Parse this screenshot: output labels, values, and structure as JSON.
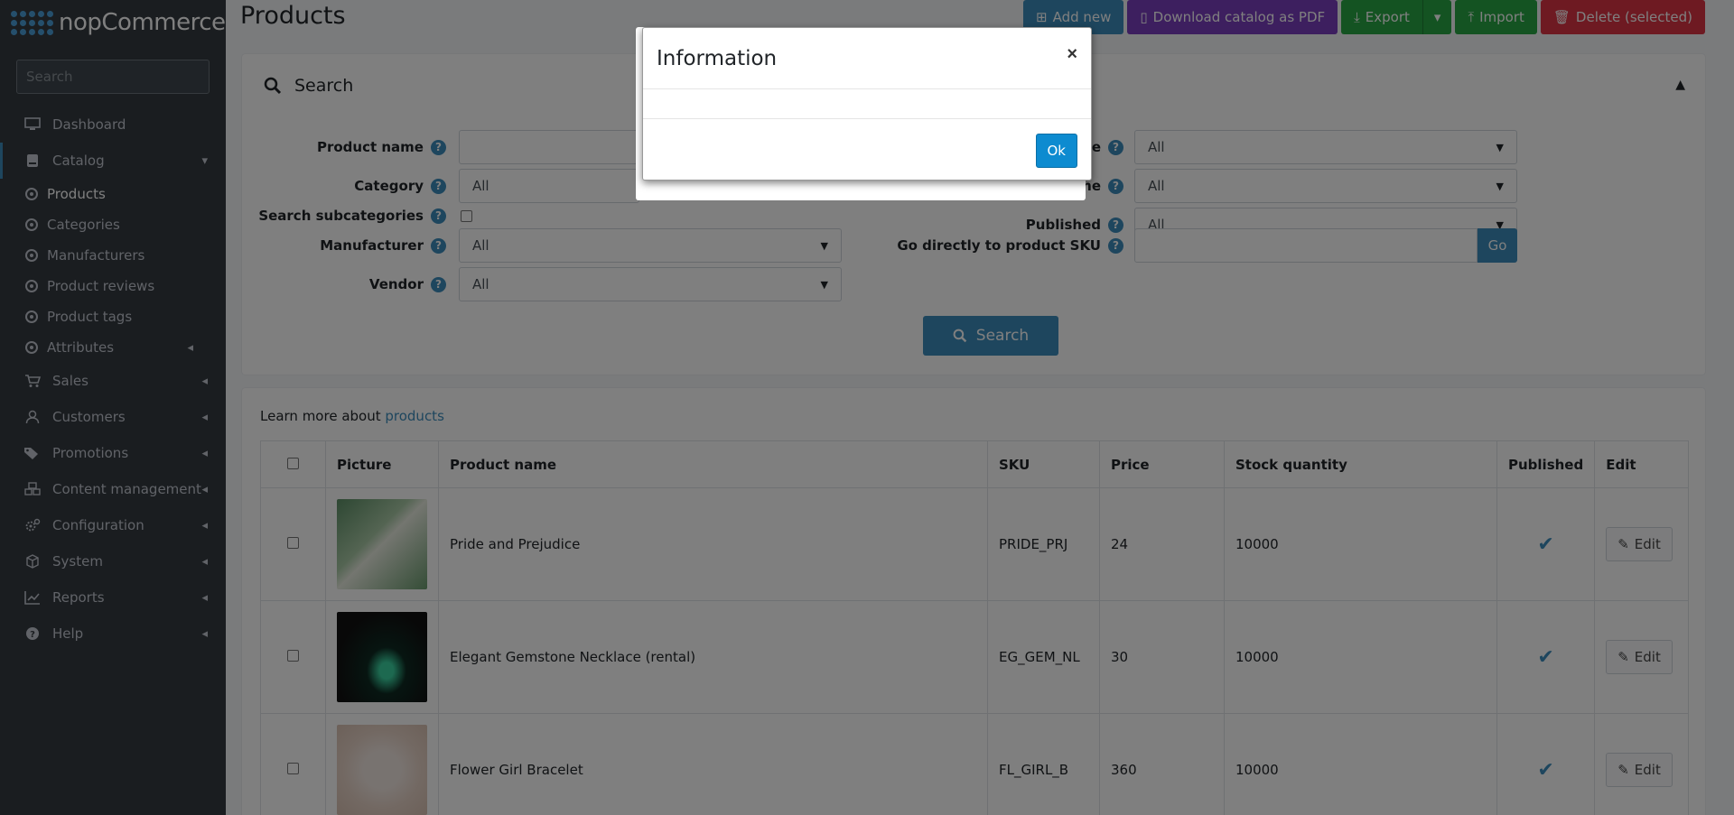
{
  "brand": {
    "name": "nopCommerce"
  },
  "sidebar": {
    "search_placeholder": "Search",
    "items": [
      {
        "label": "Dashboard",
        "icon": "monitor-icon"
      },
      {
        "label": "Catalog",
        "icon": "book-icon"
      },
      {
        "label": "Sales",
        "icon": "cart-icon"
      },
      {
        "label": "Customers",
        "icon": "user-icon"
      },
      {
        "label": "Promotions",
        "icon": "tags-icon"
      },
      {
        "label": "Content management",
        "icon": "cubes-icon"
      },
      {
        "label": "Configuration",
        "icon": "gears-icon"
      },
      {
        "label": "System",
        "icon": "cube-icon"
      },
      {
        "label": "Reports",
        "icon": "chart-icon"
      },
      {
        "label": "Help",
        "icon": "question-icon"
      }
    ],
    "catalog_sub": [
      "Products",
      "Categories",
      "Manufacturers",
      "Product reviews",
      "Product tags",
      "Attributes"
    ]
  },
  "header": {
    "title": "Products",
    "buttons": {
      "add_new": "Add new",
      "download_pdf": "Download catalog as PDF",
      "export": "Export",
      "import": "Import",
      "delete_selected": "Delete (selected)"
    }
  },
  "search_panel": {
    "title": "Search",
    "labels": {
      "product_name": "Product name",
      "category": "Category",
      "search_subcategories": "Search subcategories",
      "manufacturer": "Manufacturer",
      "vendor": "Vendor",
      "warehouse": "se",
      "product_type": "ne",
      "published": "Published",
      "go_sku": "Go directly to product SKU"
    },
    "values": {
      "category": "All",
      "manufacturer": "All",
      "vendor": "All",
      "warehouse": "All",
      "product_type": "All",
      "published": "All"
    },
    "go_button": "Go",
    "search_button": "Search"
  },
  "products_panel": {
    "learn_more_prefix": "Learn more about",
    "learn_more_link": "products",
    "columns": [
      "Picture",
      "Product name",
      "SKU",
      "Price",
      "Stock quantity",
      "Published",
      "Edit"
    ],
    "rows": [
      {
        "name": "Pride and Prejudice",
        "sku": "PRIDE_PRJ",
        "price": "24",
        "stock": "10000",
        "published": true,
        "edit": "Edit"
      },
      {
        "name": "Elegant Gemstone Necklace (rental)",
        "sku": "EG_GEM_NL",
        "price": "30",
        "stock": "10000",
        "published": true,
        "edit": "Edit"
      },
      {
        "name": "Flower Girl Bracelet",
        "sku": "FL_GIRL_B",
        "price": "360",
        "stock": "10000",
        "published": true,
        "edit": "Edit"
      }
    ]
  },
  "modal": {
    "title": "Information",
    "close": "×",
    "ok": "Ok"
  },
  "colors": {
    "accent": "#3c8dbc",
    "sidebar_bg": "#343a40",
    "overlay": "rgba(0,0,0,0.5)",
    "ok_button": "#0d8bd0"
  }
}
